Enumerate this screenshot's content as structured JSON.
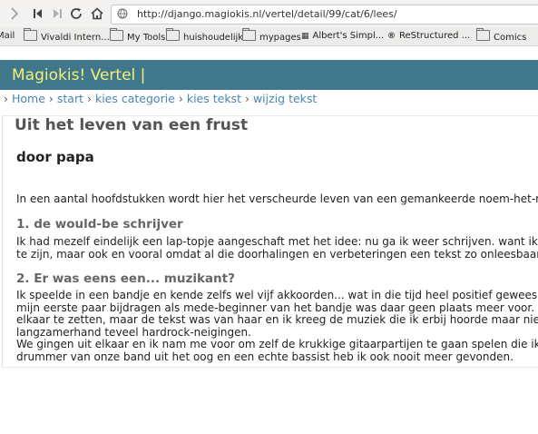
{
  "browser": {
    "url": "http://django.magiokis.nl/vertel/detail/99/cat/6/lees/",
    "bookmarks": [
      {
        "label": "Mail",
        "icon": "none"
      },
      {
        "label": "Vivaldi Intern...",
        "icon": "folder-icon"
      },
      {
        "label": "My Tools",
        "icon": "folder-icon"
      },
      {
        "label": "huishoudelijk",
        "icon": "folder-icon"
      },
      {
        "label": "mypages",
        "icon": "folder-icon"
      },
      {
        "label": "Albert's Simpl...",
        "icon": "site-icon"
      },
      {
        "label": "ReStructured ...",
        "icon": "rst-icon"
      },
      {
        "label": "Comics",
        "icon": "folder-icon"
      }
    ]
  },
  "site": {
    "title": "Magiokis! Vertel |",
    "breadcrumbs": [
      "Home",
      "start",
      "kies categorie",
      "kies tekst",
      "wijzig tekst"
    ]
  },
  "story": {
    "title": "Uit het leven van een frust",
    "author": "door papa",
    "intro": "In een aantal hoofdstukken wordt hier het verscheurde leven van een gemankeerde noem-het-maar",
    "sections": [
      {
        "heading": "1. de would-be schrijver",
        "lines": [
          "Ik had mezelf eindelijk een lap-topje aangeschaft met het idee: nu ga ik weer schrijven. want ik",
          "te zijn, maar ook en vooral omdat al die doorhalingen en verbeteringen een tekst zo onleesbaar"
        ]
      },
      {
        "heading": "2. Er was eens een... muzikant?",
        "lines": [
          "Ik speelde in een bandje en kende zelfs wel vijf akkoorden... wat in die tijd heel positief gewees",
          "mijn eerste paar bijdragen als mede-beginner van het bandje was daar geen plaats meer voor.",
          "elkaar te zetten, maar de tekst was van haar en ik kreeg de muziek die ik erbij hoorde maar nie",
          "langzamerhand teveel hardrock-neigingen.",
          "We gingen uit elkaar en ik nam me voor om zelf de krukkige gitaarpartijen te gaan spelen die ik",
          "drummer van onze band uit het oog en een echte bassist heb ik ook nooit meer gevonden."
        ]
      }
    ]
  }
}
